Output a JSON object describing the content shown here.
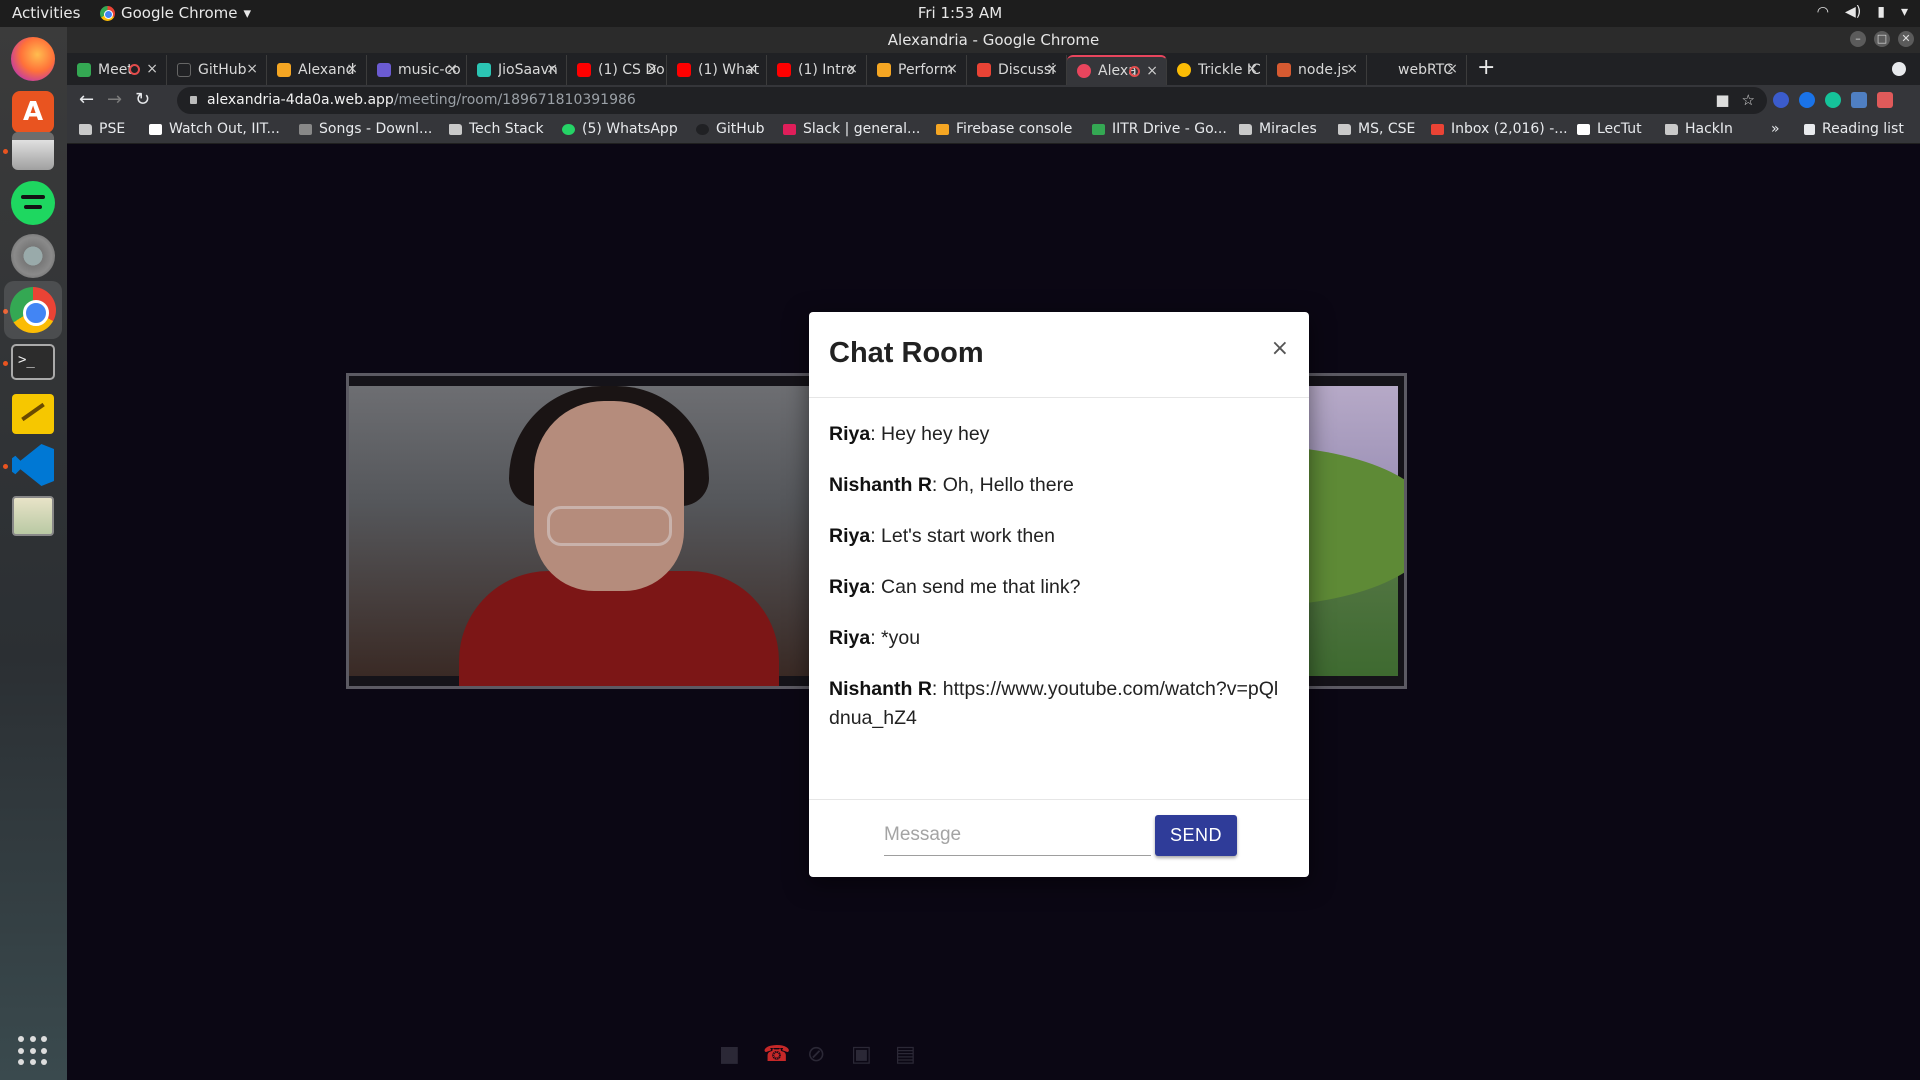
{
  "system": {
    "activities": "Activities",
    "app_name": "Google Chrome",
    "clock": "Fri  1:53 AM"
  },
  "window": {
    "title": "Alexandria - Google Chrome"
  },
  "tabs": [
    {
      "label": "Meet",
      "favicon_color": "#34a853",
      "recording": true
    },
    {
      "label": "GitHub",
      "favicon_color": "#202124"
    },
    {
      "label": "Alexand",
      "favicon_color": "#f5a623"
    },
    {
      "label": "music-co",
      "favicon_color": "#6b5bd2"
    },
    {
      "label": "JioSaavn",
      "favicon_color": "#2bc5b4"
    },
    {
      "label": "(1) CS Do",
      "favicon_color": "#ff0000"
    },
    {
      "label": "(1) What",
      "favicon_color": "#ff0000"
    },
    {
      "label": "(1) Intro",
      "favicon_color": "#ff0000"
    },
    {
      "label": "Perform",
      "favicon_color": "#f5a623"
    },
    {
      "label": "Discussi",
      "favicon_color": "#ea4335"
    },
    {
      "label": "Alexa",
      "favicon_color": "#e8455d",
      "recording": true,
      "active": true
    },
    {
      "label": "Trickle IC",
      "favicon_color": "#fbbc05"
    },
    {
      "label": "node.js",
      "favicon_color": "#d65a31"
    },
    {
      "label": "webRTC",
      "favicon_color": "#202124"
    }
  ],
  "address": {
    "host": "alexandria-4da0a.web.app",
    "path": "/meeting/room/189671810391986"
  },
  "bookmarks": [
    {
      "label": "PSE",
      "folder": true
    },
    {
      "label": "Watch Out, IIT...",
      "folder": false
    },
    {
      "label": "Songs - Downl...",
      "folder": false
    },
    {
      "label": "Tech Stack",
      "folder": true
    },
    {
      "label": "(5) WhatsApp",
      "folder": false
    },
    {
      "label": "GitHub",
      "folder": false
    },
    {
      "label": "Slack | general...",
      "folder": false
    },
    {
      "label": "Firebase console",
      "folder": false
    },
    {
      "label": "IITR Drive - Go...",
      "folder": false
    },
    {
      "label": "Miracles",
      "folder": true
    },
    {
      "label": "MS, CSE",
      "folder": true
    },
    {
      "label": "Inbox (2,016) -...",
      "folder": false
    },
    {
      "label": "LecTut",
      "folder": false
    },
    {
      "label": "HackIn",
      "folder": true
    }
  ],
  "bookmarks_more": "»",
  "reading_list": "Reading list",
  "chat": {
    "title": "Chat Room",
    "close": "×",
    "messages": [
      {
        "sender": "Riya",
        "text": ": Hey hey hey"
      },
      {
        "sender": "Nishanth R",
        "text": ": Oh, Hello there"
      },
      {
        "sender": "Riya",
        "text": ": Let's start work then"
      },
      {
        "sender": "Riya",
        "text": ": Can send me that link?"
      },
      {
        "sender": "Riya",
        "text": ": *you"
      },
      {
        "sender": "Nishanth R",
        "text": ": https://www.youtube.com/watch?v=pQldnua_hZ4"
      }
    ],
    "input_placeholder": "Message",
    "send_label": "SEND"
  },
  "icons": {
    "back": "back-arrow-icon",
    "forward": "forward-arrow-icon",
    "reload": "reload-icon",
    "camera": "video-camera-icon",
    "hangup": "phone-hangup-icon",
    "mic_off": "mic-off-icon",
    "screen_off": "screen-share-off-icon",
    "chat": "chat-icon"
  },
  "colors": {
    "accent_tab": "#e8455d",
    "send_button": "#2f3c99",
    "hangup": "#c62828"
  }
}
